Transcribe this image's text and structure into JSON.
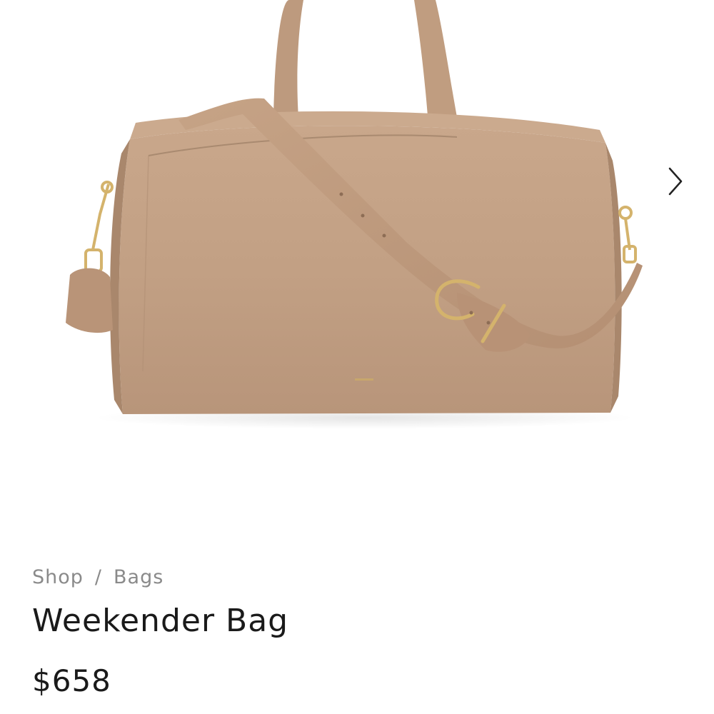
{
  "breadcrumb": {
    "items": [
      "Shop",
      "Bags"
    ],
    "separator": "/"
  },
  "product": {
    "title": "Weekender Bag",
    "price": "$658",
    "image_alt": "Weekender Bag",
    "leather_color": "#c2a084",
    "hardware_color": "#d4b36c"
  },
  "gallery": {
    "next_icon": "chevron-right-icon"
  }
}
